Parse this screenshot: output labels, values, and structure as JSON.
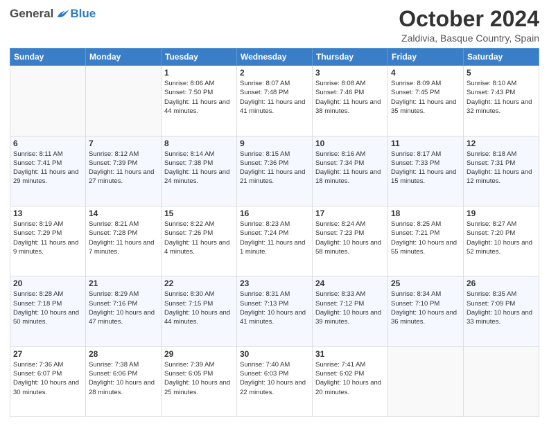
{
  "header": {
    "logo_general": "General",
    "logo_blue": "Blue",
    "month_title": "October 2024",
    "location": "Zaldivia, Basque Country, Spain"
  },
  "days_of_week": [
    "Sunday",
    "Monday",
    "Tuesday",
    "Wednesday",
    "Thursday",
    "Friday",
    "Saturday"
  ],
  "weeks": [
    [
      {
        "day": "",
        "info": ""
      },
      {
        "day": "",
        "info": ""
      },
      {
        "day": "1",
        "info": "Sunrise: 8:06 AM\nSunset: 7:50 PM\nDaylight: 11 hours and 44 minutes."
      },
      {
        "day": "2",
        "info": "Sunrise: 8:07 AM\nSunset: 7:48 PM\nDaylight: 11 hours and 41 minutes."
      },
      {
        "day": "3",
        "info": "Sunrise: 8:08 AM\nSunset: 7:46 PM\nDaylight: 11 hours and 38 minutes."
      },
      {
        "day": "4",
        "info": "Sunrise: 8:09 AM\nSunset: 7:45 PM\nDaylight: 11 hours and 35 minutes."
      },
      {
        "day": "5",
        "info": "Sunrise: 8:10 AM\nSunset: 7:43 PM\nDaylight: 11 hours and 32 minutes."
      }
    ],
    [
      {
        "day": "6",
        "info": "Sunrise: 8:11 AM\nSunset: 7:41 PM\nDaylight: 11 hours and 29 minutes."
      },
      {
        "day": "7",
        "info": "Sunrise: 8:12 AM\nSunset: 7:39 PM\nDaylight: 11 hours and 27 minutes."
      },
      {
        "day": "8",
        "info": "Sunrise: 8:14 AM\nSunset: 7:38 PM\nDaylight: 11 hours and 24 minutes."
      },
      {
        "day": "9",
        "info": "Sunrise: 8:15 AM\nSunset: 7:36 PM\nDaylight: 11 hours and 21 minutes."
      },
      {
        "day": "10",
        "info": "Sunrise: 8:16 AM\nSunset: 7:34 PM\nDaylight: 11 hours and 18 minutes."
      },
      {
        "day": "11",
        "info": "Sunrise: 8:17 AM\nSunset: 7:33 PM\nDaylight: 11 hours and 15 minutes."
      },
      {
        "day": "12",
        "info": "Sunrise: 8:18 AM\nSunset: 7:31 PM\nDaylight: 11 hours and 12 minutes."
      }
    ],
    [
      {
        "day": "13",
        "info": "Sunrise: 8:19 AM\nSunset: 7:29 PM\nDaylight: 11 hours and 9 minutes."
      },
      {
        "day": "14",
        "info": "Sunrise: 8:21 AM\nSunset: 7:28 PM\nDaylight: 11 hours and 7 minutes."
      },
      {
        "day": "15",
        "info": "Sunrise: 8:22 AM\nSunset: 7:26 PM\nDaylight: 11 hours and 4 minutes."
      },
      {
        "day": "16",
        "info": "Sunrise: 8:23 AM\nSunset: 7:24 PM\nDaylight: 11 hours and 1 minute."
      },
      {
        "day": "17",
        "info": "Sunrise: 8:24 AM\nSunset: 7:23 PM\nDaylight: 10 hours and 58 minutes."
      },
      {
        "day": "18",
        "info": "Sunrise: 8:25 AM\nSunset: 7:21 PM\nDaylight: 10 hours and 55 minutes."
      },
      {
        "day": "19",
        "info": "Sunrise: 8:27 AM\nSunset: 7:20 PM\nDaylight: 10 hours and 52 minutes."
      }
    ],
    [
      {
        "day": "20",
        "info": "Sunrise: 8:28 AM\nSunset: 7:18 PM\nDaylight: 10 hours and 50 minutes."
      },
      {
        "day": "21",
        "info": "Sunrise: 8:29 AM\nSunset: 7:16 PM\nDaylight: 10 hours and 47 minutes."
      },
      {
        "day": "22",
        "info": "Sunrise: 8:30 AM\nSunset: 7:15 PM\nDaylight: 10 hours and 44 minutes."
      },
      {
        "day": "23",
        "info": "Sunrise: 8:31 AM\nSunset: 7:13 PM\nDaylight: 10 hours and 41 minutes."
      },
      {
        "day": "24",
        "info": "Sunrise: 8:33 AM\nSunset: 7:12 PM\nDaylight: 10 hours and 39 minutes."
      },
      {
        "day": "25",
        "info": "Sunrise: 8:34 AM\nSunset: 7:10 PM\nDaylight: 10 hours and 36 minutes."
      },
      {
        "day": "26",
        "info": "Sunrise: 8:35 AM\nSunset: 7:09 PM\nDaylight: 10 hours and 33 minutes."
      }
    ],
    [
      {
        "day": "27",
        "info": "Sunrise: 7:36 AM\nSunset: 6:07 PM\nDaylight: 10 hours and 30 minutes."
      },
      {
        "day": "28",
        "info": "Sunrise: 7:38 AM\nSunset: 6:06 PM\nDaylight: 10 hours and 28 minutes."
      },
      {
        "day": "29",
        "info": "Sunrise: 7:39 AM\nSunset: 6:05 PM\nDaylight: 10 hours and 25 minutes."
      },
      {
        "day": "30",
        "info": "Sunrise: 7:40 AM\nSunset: 6:03 PM\nDaylight: 10 hours and 22 minutes."
      },
      {
        "day": "31",
        "info": "Sunrise: 7:41 AM\nSunset: 6:02 PM\nDaylight: 10 hours and 20 minutes."
      },
      {
        "day": "",
        "info": ""
      },
      {
        "day": "",
        "info": ""
      }
    ]
  ]
}
